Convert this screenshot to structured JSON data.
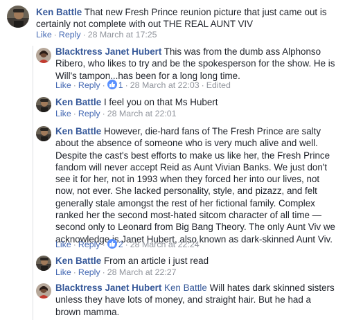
{
  "colors": {
    "name": "#365899",
    "link": "#4267b2",
    "meta": "#90949c",
    "text": "#1d2129",
    "like_badge": "#5890ff"
  },
  "icons": {
    "like_badge": "thumbs-up-icon"
  },
  "comments": [
    {
      "author": "Ken Battle",
      "text": "That new Fresh Prince reunion picture that just came out is certainly not complete with out THE REAL AUNT VIV",
      "like": "Like",
      "reply": "Reply",
      "time": "28 March at 17:25"
    },
    {
      "author": "Blacktress Janet Hubert",
      "text": "This was from the dumb ass Alphonso Ribero, who likes to try and be the spokesperson for the show. He is Will's tampon...has been for a long long time.",
      "like": "Like",
      "reply": "Reply",
      "reactions": "1",
      "time": "28 March at 22:03",
      "edited": "Edited"
    },
    {
      "author": "Ken Battle",
      "text": "I feel you on that Ms Hubert",
      "like": "Like",
      "reply": "Reply",
      "time": "28 March at 22:01"
    },
    {
      "author": "Ken Battle",
      "text": "However, die-hard fans of The Fresh Prince are salty about the absence of someone who is very much alive and well. Despite the cast's best efforts to make us like her, the Fresh Prince fandom will never accept Reid as Aunt Vivian Banks. We just don't see it for her, not in 1993 when they forced her into our lives, not now, not ever. She lacked personality, style, and pizazz, and felt generally stale amongst the rest of her fictional family. Complex ranked her the second most-hated sitcom character of all time — second only to Leonard from Big Bang Theory. The only Aunt Viv we acknowledge is Janet Hubert, also known as dark-skinned Aunt Viv.",
      "like": "Like",
      "reply": "Reply",
      "reactions": "2",
      "time": "28 March at 22:24"
    },
    {
      "author": "Ken Battle",
      "text": "From an article i just read",
      "like": "Like",
      "reply": "Reply",
      "time": "28 March at 22:27"
    },
    {
      "author": "Blacktress Janet Hubert",
      "tag": "Ken Battle",
      "text": "Will hates dark skinned sisters unless they have lots of money, and straight hair. But he had a brown mamma."
    }
  ]
}
